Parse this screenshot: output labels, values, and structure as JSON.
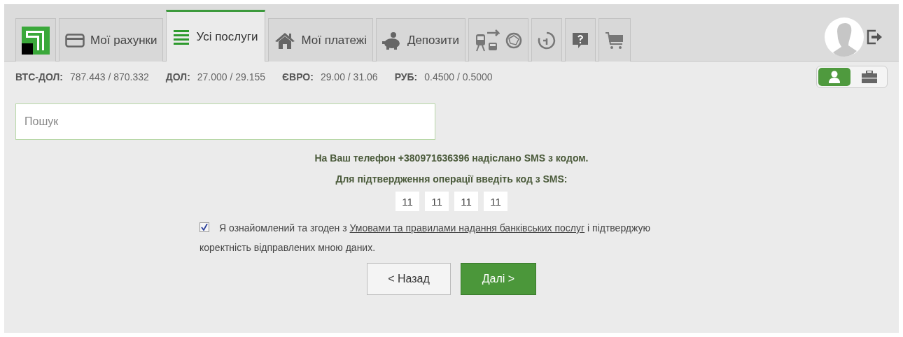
{
  "tabs": [
    {
      "kind": "logo",
      "selected": false
    },
    {
      "kind": "text",
      "label": "Мої рахунки",
      "selected": false
    },
    {
      "kind": "text",
      "label": "Усі послуги",
      "selected": true
    },
    {
      "kind": "text",
      "label": "Мої платежі",
      "selected": false
    },
    {
      "kind": "text",
      "label": "Депозити",
      "selected": false
    },
    {
      "kind": "icons",
      "selected": false
    },
    {
      "kind": "icons",
      "selected": false
    },
    {
      "kind": "icons",
      "selected": false
    },
    {
      "kind": "icons",
      "selected": false
    }
  ],
  "rates": [
    {
      "name": "ВТС-ДОЛ:",
      "value": "787.443 / 870.332"
    },
    {
      "name": "ДОЛ:",
      "value": "27.000 / 29.155"
    },
    {
      "name": "ЄВРО:",
      "value": "29.00 / 31.06"
    },
    {
      "name": "РУБ:",
      "value": "0.4500 / 0.5000"
    }
  ],
  "account_type": [
    {
      "selected": true
    },
    {
      "selected": false
    }
  ],
  "search": {
    "placeholder": "Пошук"
  },
  "messages": [
    "На Ваш телефон +380971636396 надіслано SMS з кодом.",
    "Для підтвердження операції введіть код з SMS:"
  ],
  "code_fields": [
    "11",
    "11",
    "11",
    "11"
  ],
  "agreement": {
    "checked": true,
    "text_before": "Я ознайомлений та згоден з",
    "link": "Умовами та правилами надання банківських послуг",
    "text_after": "і підтверджую",
    "continuation": "коректність відправлених мною даних."
  },
  "buttons": [
    {
      "kind": "secondary",
      "label": "< Назад"
    },
    {
      "kind": "primary",
      "label": "Далі >"
    }
  ]
}
